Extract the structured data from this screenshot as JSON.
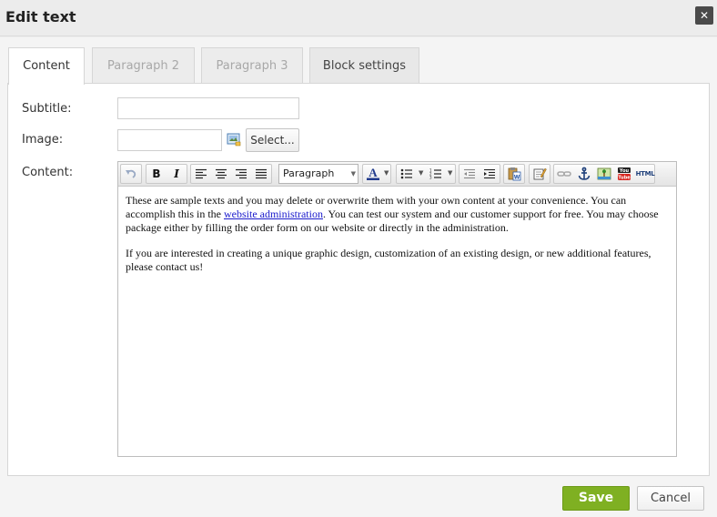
{
  "dialog": {
    "title": "Edit text",
    "close_glyph": "✕"
  },
  "tabs": [
    {
      "label": "Content",
      "state": "active"
    },
    {
      "label": "Paragraph 2",
      "state": "disabled"
    },
    {
      "label": "Paragraph 3",
      "state": "disabled"
    },
    {
      "label": "Block settings",
      "state": "normal"
    }
  ],
  "form": {
    "subtitle_label": "Subtitle:",
    "subtitle_value": "",
    "image_label": "Image:",
    "image_value": "",
    "select_button": "Select...",
    "content_label": "Content:"
  },
  "toolbar": {
    "bold": "B",
    "italic": "I",
    "format_value": "Paragraph",
    "font_color_glyph": "A",
    "html_label": "HTML",
    "icons": [
      "undo-icon",
      "bold-icon",
      "italic-icon",
      "align-left-icon",
      "align-center-icon",
      "align-right-icon",
      "align-justify-icon",
      "format-select",
      "font-color-icon",
      "bullet-list-icon",
      "numbered-list-icon",
      "outdent-icon",
      "indent-icon",
      "paste-word-icon",
      "edit-icon",
      "unlink-icon",
      "anchor-icon",
      "image-icon",
      "youtube-icon",
      "html-icon"
    ]
  },
  "editor": {
    "p1_before_link": "These are sample texts and you may delete or overwrite them with your own content at your convenience. You can accomplish this in the ",
    "p1_link": "website administration",
    "p1_after_link": ". You can test our system and our customer support for free. You may choose package either by filling the order form on our website or directly in the administration.",
    "p2": "If you are interested in creating a unique graphic design, customization of an existing design, or new additional features, please contact us!"
  },
  "buttons": {
    "save": "Save",
    "cancel": "Cancel"
  },
  "colors": {
    "save_green": "#7fb022",
    "link_blue": "#1a1acc",
    "close_bg": "#4a4a4a"
  }
}
